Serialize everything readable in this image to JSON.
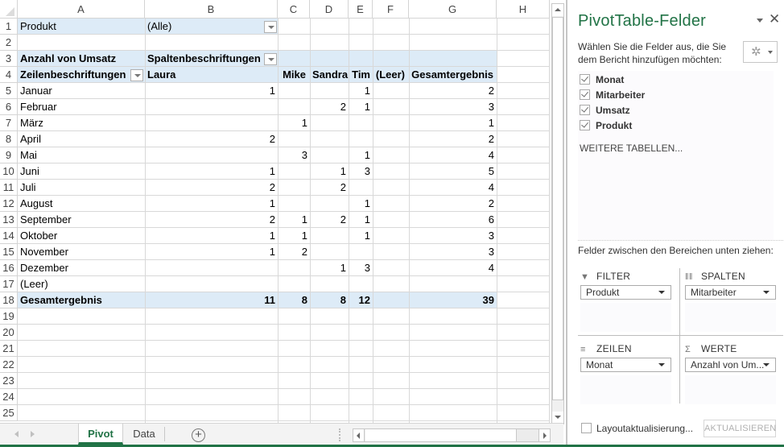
{
  "sheet": {
    "columns": [
      "A",
      "B",
      "C",
      "D",
      "E",
      "F",
      "G",
      "H"
    ],
    "rows": [
      "1",
      "2",
      "3",
      "4",
      "5",
      "6",
      "7",
      "8",
      "9",
      "10",
      "11",
      "12",
      "13",
      "14",
      "15",
      "16",
      "17",
      "18",
      "19",
      "20",
      "21",
      "22",
      "23",
      "24",
      "25"
    ],
    "filter": {
      "label": "Produkt",
      "value": "(Alle)"
    },
    "values_label": "Anzahl von Umsatz",
    "column_labels_header": "Spaltenbeschriftungen",
    "row_labels_header": "Zeilenbeschriftungen",
    "column_items": [
      "Laura",
      "Mike",
      "Sandra",
      "Tim",
      "(Leer)",
      "Gesamtergebnis"
    ],
    "data_rows": [
      {
        "label": "Januar",
        "values": [
          "1",
          "",
          "",
          "1",
          "",
          "2"
        ]
      },
      {
        "label": "Februar",
        "values": [
          "",
          "",
          "2",
          "1",
          "",
          "3"
        ]
      },
      {
        "label": "März",
        "values": [
          "",
          "1",
          "",
          "",
          "",
          "1"
        ]
      },
      {
        "label": "April",
        "values": [
          "2",
          "",
          "",
          "",
          "",
          "2"
        ]
      },
      {
        "label": "Mai",
        "values": [
          "",
          "3",
          "",
          "1",
          "",
          "4"
        ]
      },
      {
        "label": "Juni",
        "values": [
          "1",
          "",
          "1",
          "3",
          "",
          "5"
        ]
      },
      {
        "label": "Juli",
        "values": [
          "2",
          "",
          "2",
          "",
          "",
          "4"
        ]
      },
      {
        "label": "August",
        "values": [
          "1",
          "",
          "",
          "1",
          "",
          "2"
        ]
      },
      {
        "label": "September",
        "values": [
          "2",
          "1",
          "2",
          "1",
          "",
          "6"
        ]
      },
      {
        "label": "Oktober",
        "values": [
          "1",
          "1",
          "",
          "1",
          "",
          "3"
        ]
      },
      {
        "label": "November",
        "values": [
          "1",
          "2",
          "",
          "",
          "",
          "3"
        ]
      },
      {
        "label": "Dezember",
        "values": [
          "",
          "",
          "1",
          "3",
          "",
          "4"
        ]
      },
      {
        "label": "(Leer)",
        "values": [
          "",
          "",
          "",
          "",
          "",
          ""
        ]
      }
    ],
    "total_row": {
      "label": "Gesamtergebnis",
      "values": [
        "11",
        "8",
        "8",
        "12",
        "",
        "39"
      ]
    }
  },
  "tabs": {
    "items": [
      {
        "label": "Pivot",
        "active": true
      },
      {
        "label": "Data",
        "active": false
      }
    ],
    "add_icon": "+"
  },
  "pane": {
    "title": "PivotTable-Felder",
    "close_icon": "✕",
    "description": "Wählen Sie die Felder aus, die Sie dem Bericht hinzufügen möchten:",
    "gear_icon": "✲",
    "fields": [
      {
        "label": "Monat",
        "checked": true
      },
      {
        "label": "Mitarbeiter",
        "checked": true
      },
      {
        "label": "Umsatz",
        "checked": true
      },
      {
        "label": "Produkt",
        "checked": true
      }
    ],
    "more_tables": "WEITERE TABELLEN...",
    "areas_hint": "Felder zwischen den Bereichen unten ziehen:",
    "areas": {
      "filter": {
        "title": "FILTER",
        "icon": "▼",
        "item": "Produkt"
      },
      "columns": {
        "title": "SPALTEN",
        "icon": "‖‖",
        "item": "Mitarbeiter"
      },
      "rows": {
        "title": "ZEILEN",
        "icon": "≡",
        "item": "Monat"
      },
      "values": {
        "title": "WERTE",
        "icon": "Σ",
        "item": "Anzahl von Um..."
      }
    },
    "defer_label": "Layoutaktualisierung...",
    "update_button": "AKTUALISIEREN"
  },
  "colors": {
    "accent": "#217346",
    "pivot_band": "#ddebf7",
    "total_line": "#9bc2e6"
  }
}
